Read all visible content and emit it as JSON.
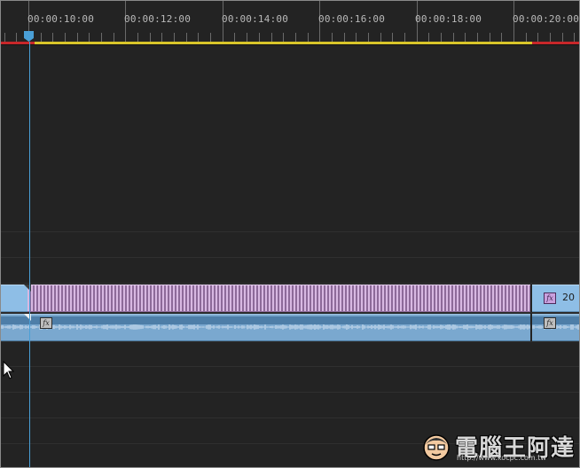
{
  "ruler": {
    "timecodes": [
      "00:00:10:00",
      "00:00:12:00",
      "00:00:14:00",
      "00:00:16:00",
      "00:00:18:00",
      "00:00:20:00"
    ]
  },
  "timeline": {
    "video_clip": {
      "fx_label": "fx",
      "trailing_label": "20"
    },
    "audio_clip": {
      "fx_label": "fx"
    }
  },
  "colors": {
    "panel_bg": "#232323",
    "video_clip": "#cba7d6",
    "audio_clip": "#7aa8cf",
    "playhead": "#4a9fd6",
    "work_area": "#d8c52a",
    "work_area_out": "#c7272a"
  },
  "icons": {
    "playhead": "playhead-marker-icon",
    "fx": "fx-badge-icon",
    "cursor": "mouse-pointer-icon"
  },
  "watermark": {
    "text": "電腦王阿達",
    "url": "http://www.kocpc.com.tw"
  }
}
